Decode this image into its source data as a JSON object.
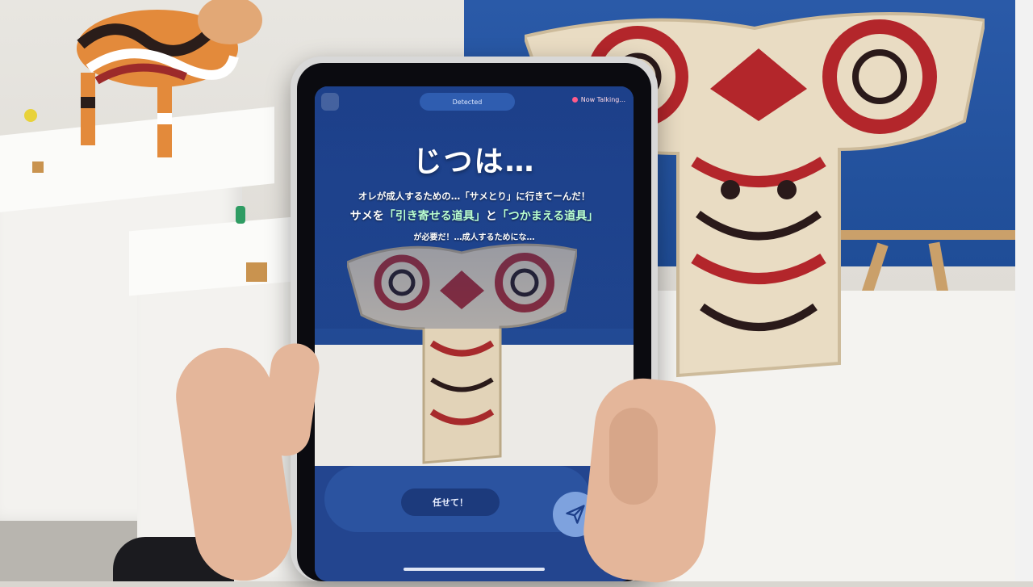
{
  "app": {
    "status_pill": "Detected",
    "now_talking": "Now Talking...",
    "headline": "じつは…",
    "line1": "オレが成人するための…「サメとり」に行きてーんだ！",
    "line2_prefix": "サメを",
    "line2_highlight_a": "「引き寄せる道具」",
    "line2_mid": "と",
    "line2_highlight_b": "「つかまえる道具」",
    "line3": "が必要だ！…成人するためにな…",
    "action_button": "任せて！",
    "send_icon": "paper-plane-icon"
  },
  "colors": {
    "screen_blue": "#1d3f8a",
    "highlight_green": "#b9ffd2",
    "artifact_red": "#b3262b",
    "artifact_cream": "#e9dcc3"
  }
}
